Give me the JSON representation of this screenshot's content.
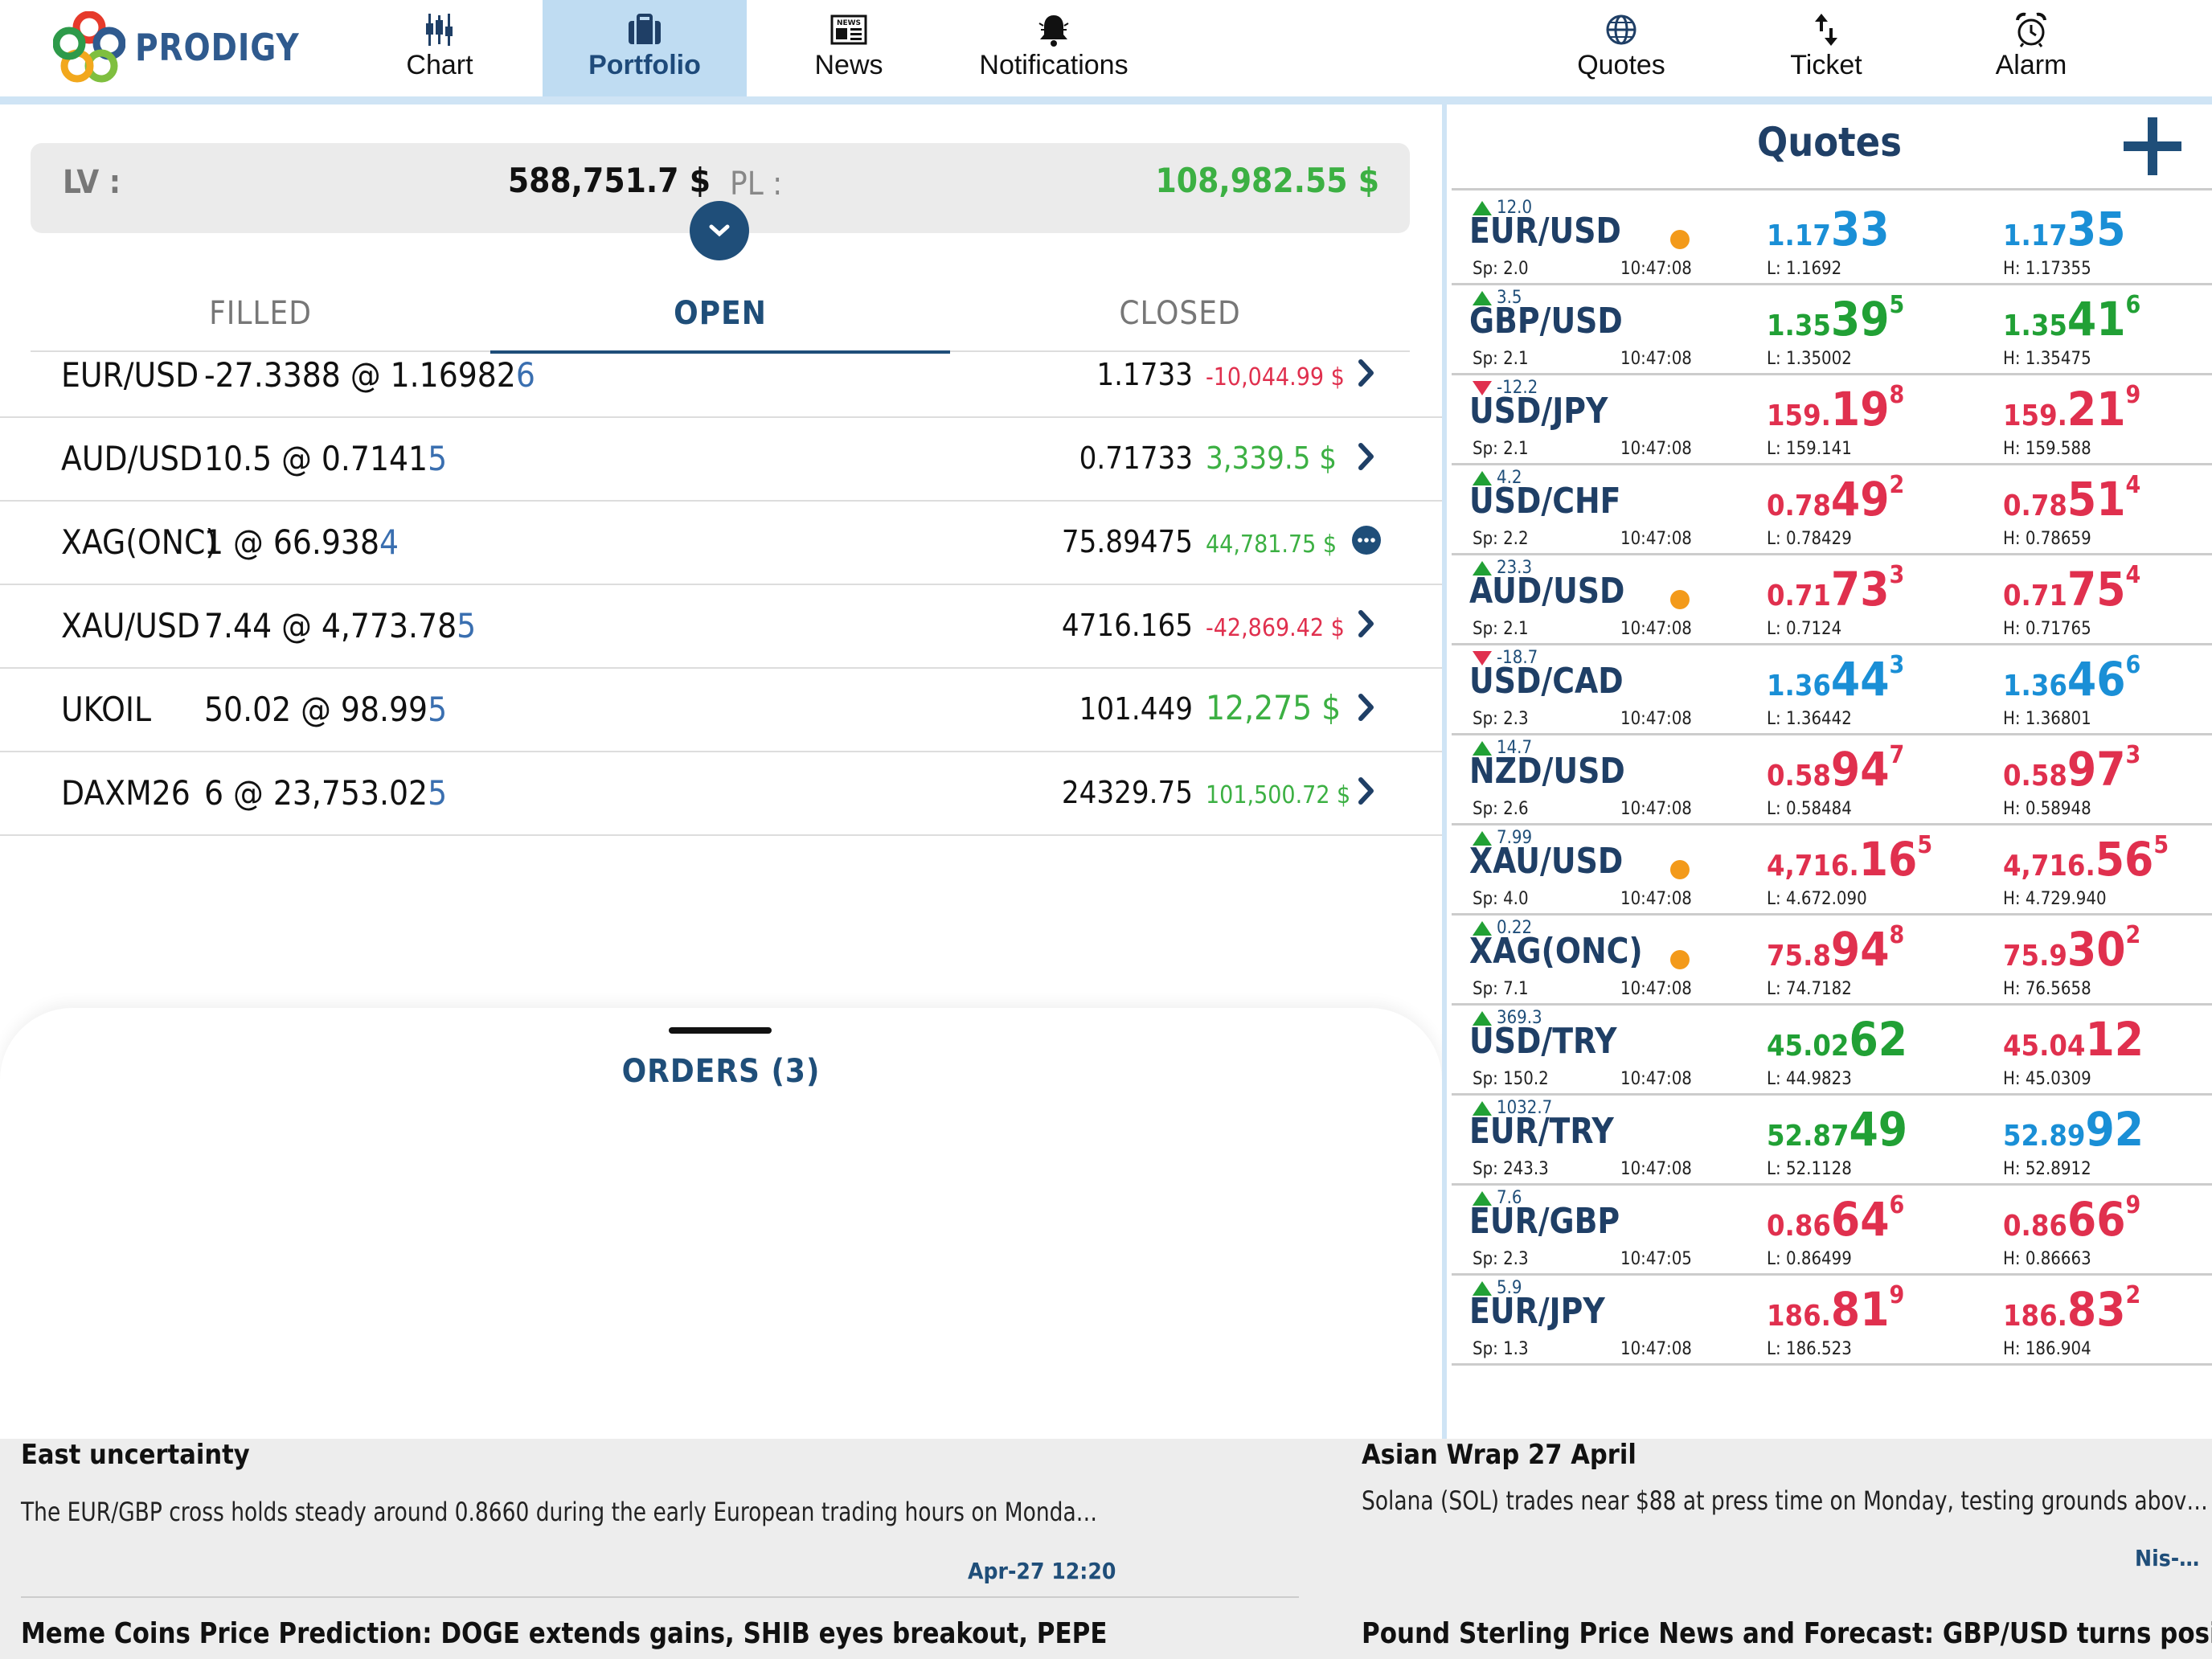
{
  "app": {
    "name": "PRODIGY"
  },
  "nav": {
    "left": [
      {
        "label": "Chart",
        "icon": "chart-icon"
      },
      {
        "label": "Portfolio",
        "icon": "briefcase-icon",
        "active": true
      },
      {
        "label": "News",
        "icon": "newspaper-icon"
      },
      {
        "label": "Notifications",
        "icon": "bell-icon"
      }
    ],
    "right": [
      {
        "label": "Quotes",
        "icon": "globe-icon"
      },
      {
        "label": "Ticket",
        "icon": "arrows-icon"
      },
      {
        "label": "Alarm",
        "icon": "alarm-clock-icon"
      }
    ]
  },
  "summary": {
    "lv_label": "LV :",
    "lv_value": "588,751.7 $",
    "pl_label": "PL :",
    "pl_value": "108,982.55 $"
  },
  "tabs": {
    "filled": "FILLED",
    "open": "OPEN",
    "closed": "CLOSED"
  },
  "positions": [
    {
      "symbol": "EUR/USD",
      "qty": "-27.3388 @ 1.16982",
      "last": "6",
      "current": "1.1733",
      "pnl": "-10,044.99 $",
      "pnl_sign": "neg",
      "pnl_size": "small",
      "action": "chevron"
    },
    {
      "symbol": "AUD/USD",
      "qty": "10.5 @ 0.7141",
      "last": "5",
      "current": "0.71733",
      "pnl": "3,339.5 $",
      "pnl_sign": "pos",
      "pnl_size": "normal",
      "action": "chevron"
    },
    {
      "symbol": "XAG(ONC)",
      "qty": "1 @ 66.938",
      "last": "4",
      "current": "75.89475",
      "pnl": "44,781.75 $",
      "pnl_sign": "pos",
      "pnl_size": "small",
      "action": "more"
    },
    {
      "symbol": "XAU/USD",
      "qty": "7.44 @ 4,773.78",
      "last": "5",
      "current": "4716.165",
      "pnl": "-42,869.42 $",
      "pnl_sign": "neg",
      "pnl_size": "small",
      "action": "chevron"
    },
    {
      "symbol": "UKOIL",
      "qty": "50.02 @ 98.99",
      "last": "5",
      "current": "101.449",
      "pnl": "12,275 $",
      "pnl_sign": "pos",
      "pnl_size": "big",
      "action": "chevron"
    },
    {
      "symbol": "DAXM26",
      "qty": "6 @ 23,753.02",
      "last": "5",
      "current": "24329.75",
      "pnl": "101,500.72 $",
      "pnl_sign": "pos",
      "pnl_size": "small",
      "action": "chevron"
    }
  ],
  "orders": {
    "label": "ORDERS (3)"
  },
  "quotes": {
    "title": "Quotes",
    "rows": [
      {
        "pair": "EUR/USD",
        "change": "12.0",
        "dir": "up",
        "dot": true,
        "spread": "Sp: 2.0",
        "time": "10:47:08",
        "bid": [
          "1.17",
          "33",
          ""
        ],
        "ask": [
          "1.17",
          "35",
          ""
        ],
        "bid_color": "blue",
        "ask_color": "blue",
        "low": "L: 1.1692",
        "high": "H: 1.17355"
      },
      {
        "pair": "GBP/USD",
        "change": "3.5",
        "dir": "up",
        "dot": false,
        "spread": "Sp: 2.1",
        "time": "10:47:08",
        "bid": [
          "1.35",
          "39",
          "5"
        ],
        "ask": [
          "1.35",
          "41",
          "6"
        ],
        "bid_color": "green",
        "ask_color": "green",
        "low": "L: 1.35002",
        "high": "H: 1.35475"
      },
      {
        "pair": "USD/JPY",
        "change": "-12.2",
        "dir": "down",
        "dot": false,
        "spread": "Sp: 2.1",
        "time": "10:47:08",
        "bid": [
          "159.",
          "19",
          "8"
        ],
        "ask": [
          "159.",
          "21",
          "9"
        ],
        "bid_color": "red",
        "ask_color": "red",
        "low": "L: 159.141",
        "high": "H: 159.588"
      },
      {
        "pair": "USD/CHF",
        "change": "4.2",
        "dir": "up",
        "dot": false,
        "spread": "Sp: 2.2",
        "time": "10:47:08",
        "bid": [
          "0.78",
          "49",
          "2"
        ],
        "ask": [
          "0.78",
          "51",
          "4"
        ],
        "bid_color": "red",
        "ask_color": "red",
        "low": "L: 0.78429",
        "high": "H: 0.78659"
      },
      {
        "pair": "AUD/USD",
        "change": "23.3",
        "dir": "up",
        "dot": true,
        "spread": "Sp: 2.1",
        "time": "10:47:08",
        "bid": [
          "0.71",
          "73",
          "3"
        ],
        "ask": [
          "0.71",
          "75",
          "4"
        ],
        "bid_color": "red",
        "ask_color": "red",
        "low": "L: 0.7124",
        "high": "H: 0.71765"
      },
      {
        "pair": "USD/CAD",
        "change": "-18.7",
        "dir": "down",
        "dot": false,
        "spread": "Sp: 2.3",
        "time": "10:47:08",
        "bid": [
          "1.36",
          "44",
          "3"
        ],
        "ask": [
          "1.36",
          "46",
          "6"
        ],
        "bid_color": "blue",
        "ask_color": "blue",
        "low": "L: 1.36442",
        "high": "H: 1.36801"
      },
      {
        "pair": "NZD/USD",
        "change": "14.7",
        "dir": "up",
        "dot": false,
        "spread": "Sp: 2.6",
        "time": "10:47:08",
        "bid": [
          "0.58",
          "94",
          "7"
        ],
        "ask": [
          "0.58",
          "97",
          "3"
        ],
        "bid_color": "red",
        "ask_color": "red",
        "low": "L: 0.58484",
        "high": "H: 0.58948"
      },
      {
        "pair": "XAU/USD",
        "change": "7.99",
        "dir": "up",
        "dot": true,
        "spread": "Sp: 4.0",
        "time": "10:47:08",
        "bid": [
          "4,716.",
          "16",
          "5"
        ],
        "ask": [
          "4,716.",
          "56",
          "5"
        ],
        "bid_color": "red",
        "ask_color": "red",
        "low": "L: 4.672.090",
        "high": "H: 4.729.940"
      },
      {
        "pair": "XAG(ONC)",
        "change": "0.22",
        "dir": "up",
        "dot": true,
        "spread": "Sp: 7.1",
        "time": "10:47:08",
        "bid": [
          "75.8",
          "94",
          "8"
        ],
        "ask": [
          "75.9",
          "30",
          "2"
        ],
        "bid_color": "red",
        "ask_color": "red",
        "low": "L: 74.7182",
        "high": "H: 76.5658"
      },
      {
        "pair": "USD/TRY",
        "change": "369.3",
        "dir": "up",
        "dot": false,
        "spread": "Sp: 150.2",
        "time": "10:47:08",
        "bid": [
          "45.02",
          "62",
          ""
        ],
        "ask": [
          "45.04",
          "12",
          ""
        ],
        "bid_color": "green",
        "ask_color": "red",
        "low": "L: 44.9823",
        "high": "H: 45.0309"
      },
      {
        "pair": "EUR/TRY",
        "change": "1032.7",
        "dir": "up",
        "dot": false,
        "spread": "Sp: 243.3",
        "time": "10:47:08",
        "bid": [
          "52.87",
          "49",
          ""
        ],
        "ask": [
          "52.89",
          "92",
          ""
        ],
        "bid_color": "green",
        "ask_color": "blue",
        "low": "L: 52.1128",
        "high": "H: 52.8912"
      },
      {
        "pair": "EUR/GBP",
        "change": "7.6",
        "dir": "up",
        "dot": false,
        "spread": "Sp: 2.3",
        "time": "10:47:05",
        "bid": [
          "0.86",
          "64",
          "6"
        ],
        "ask": [
          "0.86",
          "66",
          "9"
        ],
        "bid_color": "red",
        "ask_color": "red",
        "low": "L: 0.86499",
        "high": "H: 0.86663"
      },
      {
        "pair": "EUR/JPY",
        "change": "5.9",
        "dir": "up",
        "dot": false,
        "spread": "Sp: 1.3",
        "time": "10:47:08",
        "bid": [
          "186.",
          "81",
          "9"
        ],
        "ask": [
          "186.",
          "83",
          "2"
        ],
        "bid_color": "red",
        "ask_color": "red",
        "low": "L: 186.523",
        "high": "H: 186.904"
      }
    ]
  },
  "news": {
    "left": {
      "title_tail": "East uncertainty",
      "desc": "The EUR/GBP cross holds steady around 0.8660 during the early European trading hours on Monda…",
      "date": "Apr-27 12:20",
      "next_title": "Meme Coins Price Prediction: DOGE extends gains, SHIB eyes breakout, PEPE"
    },
    "right": {
      "title_tail": "Asian Wrap 27 April",
      "desc": "Solana (SOL) trades near $88 at press time on Monday, testing grounds abov…",
      "date": "Nis-…",
      "next_title": "Pound Sterling Price News and Forecast: GBP/USD turns positive for"
    }
  },
  "colors": {
    "brand": "#1f4e79",
    "positive": "#3cb043",
    "negative": "#e0304e",
    "quote_blue": "#1a8fd6",
    "tab_active": "#bfdcf2"
  }
}
